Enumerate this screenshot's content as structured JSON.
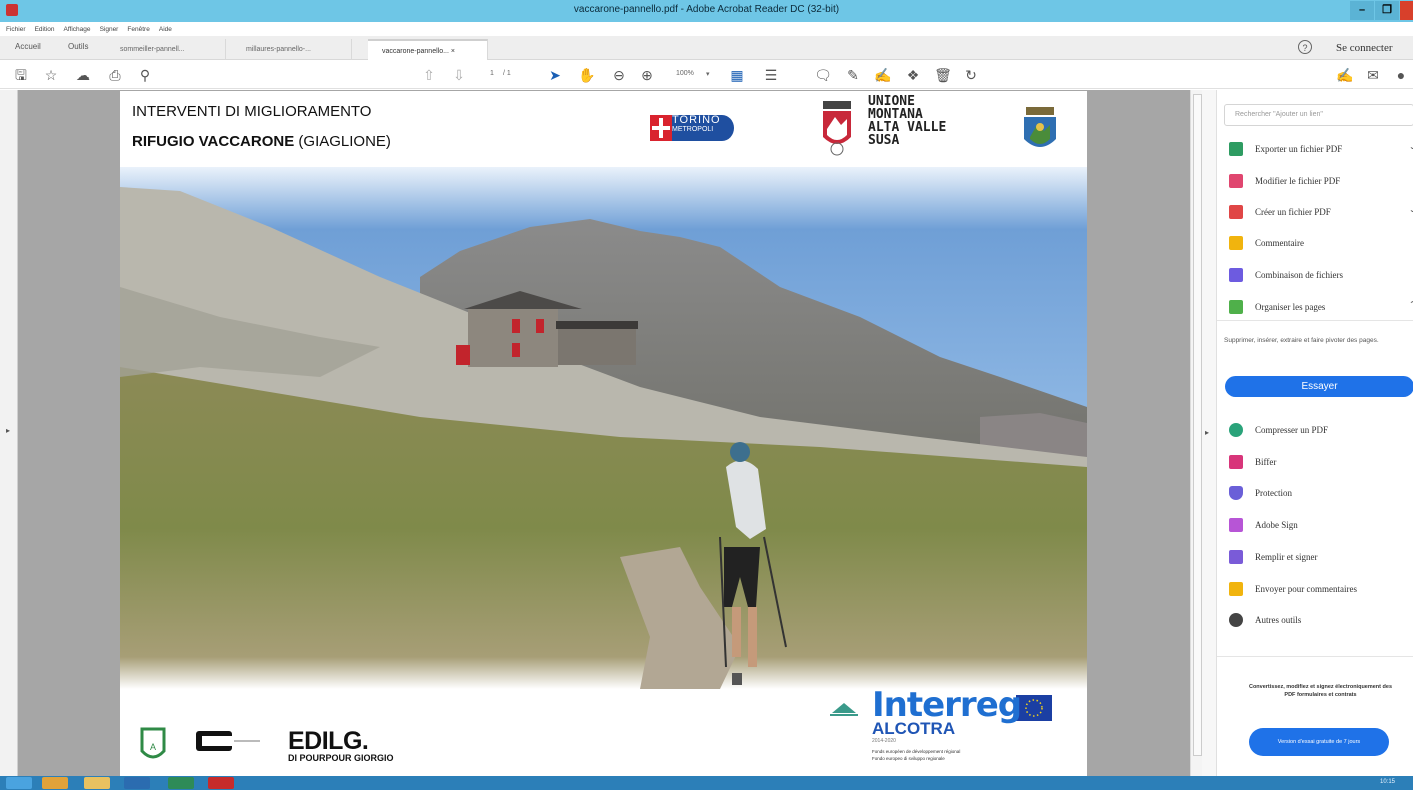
{
  "window": {
    "title": "vaccarone-pannello.pdf - Adobe Acrobat Reader DC (32-bit)"
  },
  "menu": [
    "Fichier",
    "Edition",
    "Affichage",
    "Signer",
    "Fenêtre",
    "Aide"
  ],
  "nav": {
    "home": "Accueil",
    "tools": "Outils",
    "connect": "Se connecter"
  },
  "doc_tabs": [
    {
      "label": "sommeiller-pannell..."
    },
    {
      "label": "millaures-pannello-..."
    },
    {
      "label": "vaccarone-pannello... ×"
    }
  ],
  "toolbar": {
    "page_current": "1",
    "page_total": "/ 1",
    "zoom": "100%"
  },
  "page": {
    "header_line1": "INTERVENTI DI MIGLIORAMENTO",
    "header_line2_bold": "RIFUGIO VACCARONE",
    "header_line2_rest": " (GIAGLIONE)",
    "torino": "TORINO",
    "torino_sub": "METROPOLI",
    "unione": [
      "UNIONE",
      "MONTANA",
      "ALTA VALLE",
      "SUSA"
    ],
    "edil_name": "EDILG.",
    "edil_sub": "DI POURPOUR GIORGIO",
    "interreg": "Interreg",
    "alcotra": "ALCOTRA",
    "alcotra_years": "2014-2020",
    "fund_line1": "Fonds européen de développement régional",
    "fund_line2": "Fondo europeo di sviluppo regionale"
  },
  "right_panel": {
    "search_placeholder": "Rechercher \"Ajouter un lien\"",
    "items_top": [
      {
        "label": "Exporter un fichier PDF",
        "color": "#2e9c62"
      },
      {
        "label": "Modifier le fichier PDF",
        "color": "#e0466f"
      },
      {
        "label": "Créer un fichier PDF",
        "color": "#e04646"
      },
      {
        "label": "Commentaire",
        "color": "#f1b40e"
      },
      {
        "label": "Combinaison de fichiers",
        "color": "#6d5be0"
      },
      {
        "label": "Organiser les pages",
        "color": "#4fb04a"
      }
    ],
    "description": "Supprimer, insérer, extraire et faire pivoter des pages.",
    "try_button": "Essayer",
    "items_bottom": [
      {
        "label": "Compresser un PDF",
        "color": "#2aa37a"
      },
      {
        "label": "Biffer",
        "color": "#d8357a"
      },
      {
        "label": "Protection",
        "color": "#6a5fd8"
      },
      {
        "label": "Adobe Sign",
        "color": "#b755d6"
      },
      {
        "label": "Remplir et signer",
        "color": "#7a5bd8"
      },
      {
        "label": "Envoyer pour commentaires",
        "color": "#f1b40e"
      },
      {
        "label": "Autres outils",
        "color": "#444444"
      }
    ],
    "promo": "Convertissez, modifiez et signez électroniquement des PDF formulaires et contrats",
    "trial_button": "Version d'essai gratuite de 7 jours"
  },
  "taskbar": {
    "clock": "10:15"
  }
}
